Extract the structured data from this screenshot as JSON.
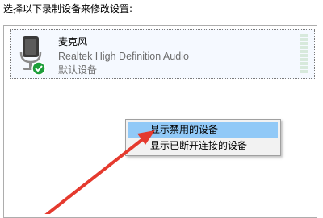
{
  "instruction": "选择以下录制设备来修改设置:",
  "devices": [
    {
      "name": "麦克风",
      "driver": "Realtek High Definition Audio",
      "status": "默认设备",
      "icon": "microphone-icon",
      "badge_icon": "check-badge-icon"
    }
  ],
  "context_menu": {
    "items": [
      {
        "label": "显示禁用的设备",
        "highlighted": true
      },
      {
        "label": "显示已断开连接的设备",
        "highlighted": false
      }
    ]
  },
  "colors": {
    "menu_highlight": "#91c9f7",
    "annotation_arrow": "#e53a2e",
    "default_badge": "#1e9e3a"
  }
}
